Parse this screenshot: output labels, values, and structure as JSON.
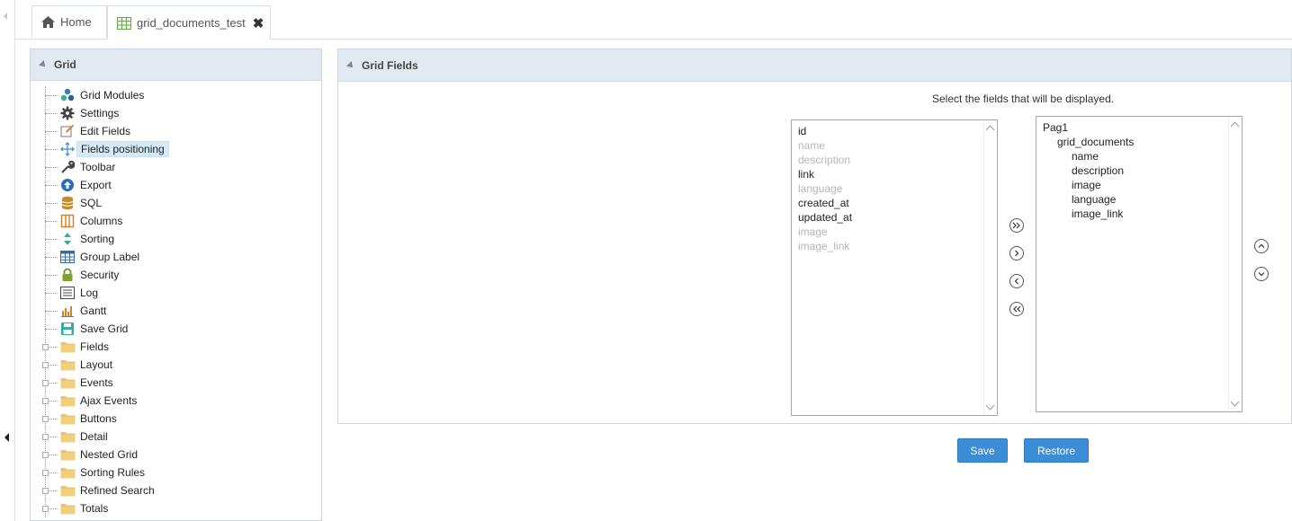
{
  "tabs": [
    {
      "label": "Home",
      "icon": "home-icon"
    },
    {
      "label": "grid_documents_test",
      "icon": "grid-table-icon",
      "close": "✖"
    }
  ],
  "left_panel": {
    "title": "Grid",
    "items": [
      {
        "label": "Grid Modules",
        "icon": "modules-icon"
      },
      {
        "label": "Settings",
        "icon": "gear-icon"
      },
      {
        "label": "Edit Fields",
        "icon": "edit-icon"
      },
      {
        "label": "Fields positioning",
        "icon": "move-icon",
        "selected": true
      },
      {
        "label": "Toolbar",
        "icon": "wrench-icon"
      },
      {
        "label": "Export",
        "icon": "upload-icon"
      },
      {
        "label": "SQL",
        "icon": "database-icon"
      },
      {
        "label": "Columns",
        "icon": "columns-icon"
      },
      {
        "label": "Sorting",
        "icon": "sort-icon"
      },
      {
        "label": "Group Label",
        "icon": "table-icon"
      },
      {
        "label": "Security",
        "icon": "lock-icon"
      },
      {
        "label": "Log",
        "icon": "log-icon"
      },
      {
        "label": "Gantt",
        "icon": "gantt-icon"
      },
      {
        "label": "Save Grid",
        "icon": "save-icon"
      },
      {
        "label": "Fields",
        "icon": "folder-icon",
        "folder": true
      },
      {
        "label": "Layout",
        "icon": "folder-icon",
        "folder": true
      },
      {
        "label": "Events",
        "icon": "folder-icon",
        "folder": true
      },
      {
        "label": "Ajax Events",
        "icon": "folder-icon",
        "folder": true
      },
      {
        "label": "Buttons",
        "icon": "folder-icon",
        "folder": true
      },
      {
        "label": "Detail",
        "icon": "folder-icon",
        "folder": true
      },
      {
        "label": "Nested Grid",
        "icon": "folder-icon",
        "folder": true
      },
      {
        "label": "Sorting Rules",
        "icon": "folder-icon",
        "folder": true
      },
      {
        "label": "Refined Search",
        "icon": "folder-icon",
        "folder": true
      },
      {
        "label": "Totals",
        "icon": "folder-icon",
        "folder": true
      }
    ]
  },
  "right_panel": {
    "title": "Grid Fields",
    "instruction": "Select the fields that will be displayed.",
    "available_fields": [
      {
        "label": "id",
        "disabled": false
      },
      {
        "label": "name",
        "disabled": true
      },
      {
        "label": "description",
        "disabled": true
      },
      {
        "label": "link",
        "disabled": false
      },
      {
        "label": "language",
        "disabled": true
      },
      {
        "label": "created_at",
        "disabled": false
      },
      {
        "label": "updated_at",
        "disabled": false
      },
      {
        "label": "image",
        "disabled": true
      },
      {
        "label": "image_link",
        "disabled": true
      }
    ],
    "selected_fields": [
      {
        "label": "Pag1",
        "level": 0
      },
      {
        "label": "grid_documents",
        "level": 1
      },
      {
        "label": "name",
        "level": 2
      },
      {
        "label": "description",
        "level": 2
      },
      {
        "label": "image",
        "level": 2
      },
      {
        "label": "language",
        "level": 2
      },
      {
        "label": "image_link",
        "level": 2
      }
    ],
    "transfer_buttons": [
      "move-all-right-icon",
      "move-right-icon",
      "move-left-icon",
      "move-all-left-icon"
    ],
    "order_buttons": [
      "move-up-icon",
      "move-down-icon"
    ]
  },
  "actions": {
    "save_label": "Save",
    "restore_label": "Restore"
  },
  "colors": {
    "accent": "#3a8dd6",
    "panel_header": "#e2e9f1",
    "selected_bg": "#d5eaf9"
  }
}
